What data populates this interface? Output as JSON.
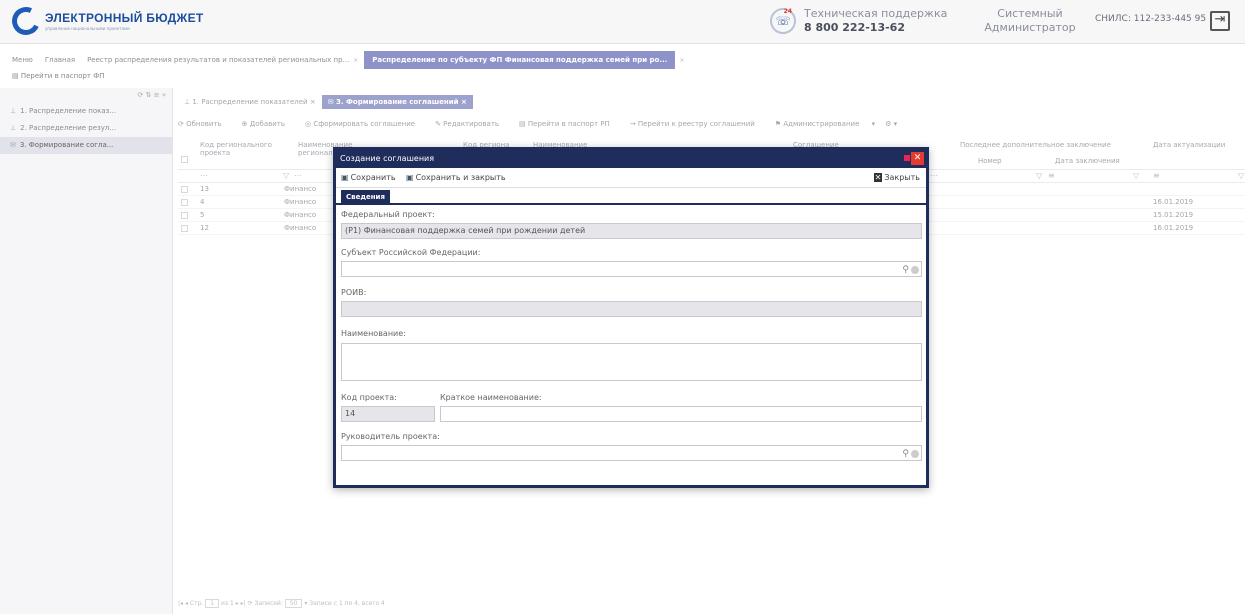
{
  "header": {
    "logo_title": "ЭЛЕКТРОННЫЙ БЮДЖЕТ",
    "logo_subtitle": "управление национальными проектами",
    "support_title": "Техническая поддержка",
    "support_phone": "8 800 222-13-62",
    "support_badge": "24",
    "user_line1": "Системный",
    "user_line2": "Администратор",
    "snils_label": "СНИЛС:",
    "snils_value": "112-233-445 95"
  },
  "page_tabs": [
    "Меню",
    "Главная",
    "Реестр распределения результатов и показателей региональных пр...",
    "Распределение по субъекту ФП Финансовая поддержка семей при ро..."
  ],
  "passport_link": "Перейти в паспорт ФП",
  "sidebar": {
    "items": [
      "1. Распределение показ...",
      "2. Распределение резул...",
      "3. Формирование согла..."
    ]
  },
  "content_tabs": [
    "1. Распределение показателей",
    "3. Формирование соглашений"
  ],
  "toolbar": [
    "Обновить",
    "Добавить",
    "Сформировать соглашение",
    "Редактировать",
    "Перейти в паспорт РП",
    "Перейти к реестру соглашений",
    "Администрирование"
  ],
  "grid": {
    "headers": {
      "code": "Код регионального проекта",
      "name": "Наименование регионального проекта",
      "region_code": "Код региона",
      "naming": "Наименование",
      "agreement": "Соглашение",
      "last_conclusion": "Последнее дополнительное заключение",
      "number": "Номер",
      "conclusion_date": "Дата заключения",
      "update_date": "Дата актуализации"
    },
    "rows": [
      {
        "code": "13",
        "name": "Финансо",
        "date": ""
      },
      {
        "code": "4",
        "name": "Финансо",
        "date": "16.01.2019"
      },
      {
        "code": "5",
        "name": "Финансо",
        "date": "15.01.2019"
      },
      {
        "code": "12",
        "name": "Финансо",
        "date": "16.01.2019"
      }
    ]
  },
  "pager": {
    "page_label": "Стр.",
    "page": "1",
    "of": "из 1",
    "records_label": "Записей:",
    "records": "50",
    "summary": "Записи с 1 по 4, всего 4"
  },
  "dialog": {
    "title": "Создание соглашения",
    "save": "Сохранить",
    "save_close": "Сохранить и закрыть",
    "close": "Закрыть",
    "tab": "Сведения",
    "fields": {
      "federal_project_label": "Федеральный проект:",
      "federal_project_value": "(P1) Финансовая поддержка семей при рождении детей",
      "subject_label": "Субъект Российской Федерации:",
      "subject_value": "",
      "roiv_label": "РОИВ:",
      "roiv_value": "",
      "name_label": "Наименование:",
      "name_value": "",
      "project_code_label": "Код проекта:",
      "project_code_value": "14",
      "short_name_label": "Краткое наименование:",
      "short_name_value": "",
      "manager_label": "Руководитель проекта:",
      "manager_value": ""
    }
  }
}
